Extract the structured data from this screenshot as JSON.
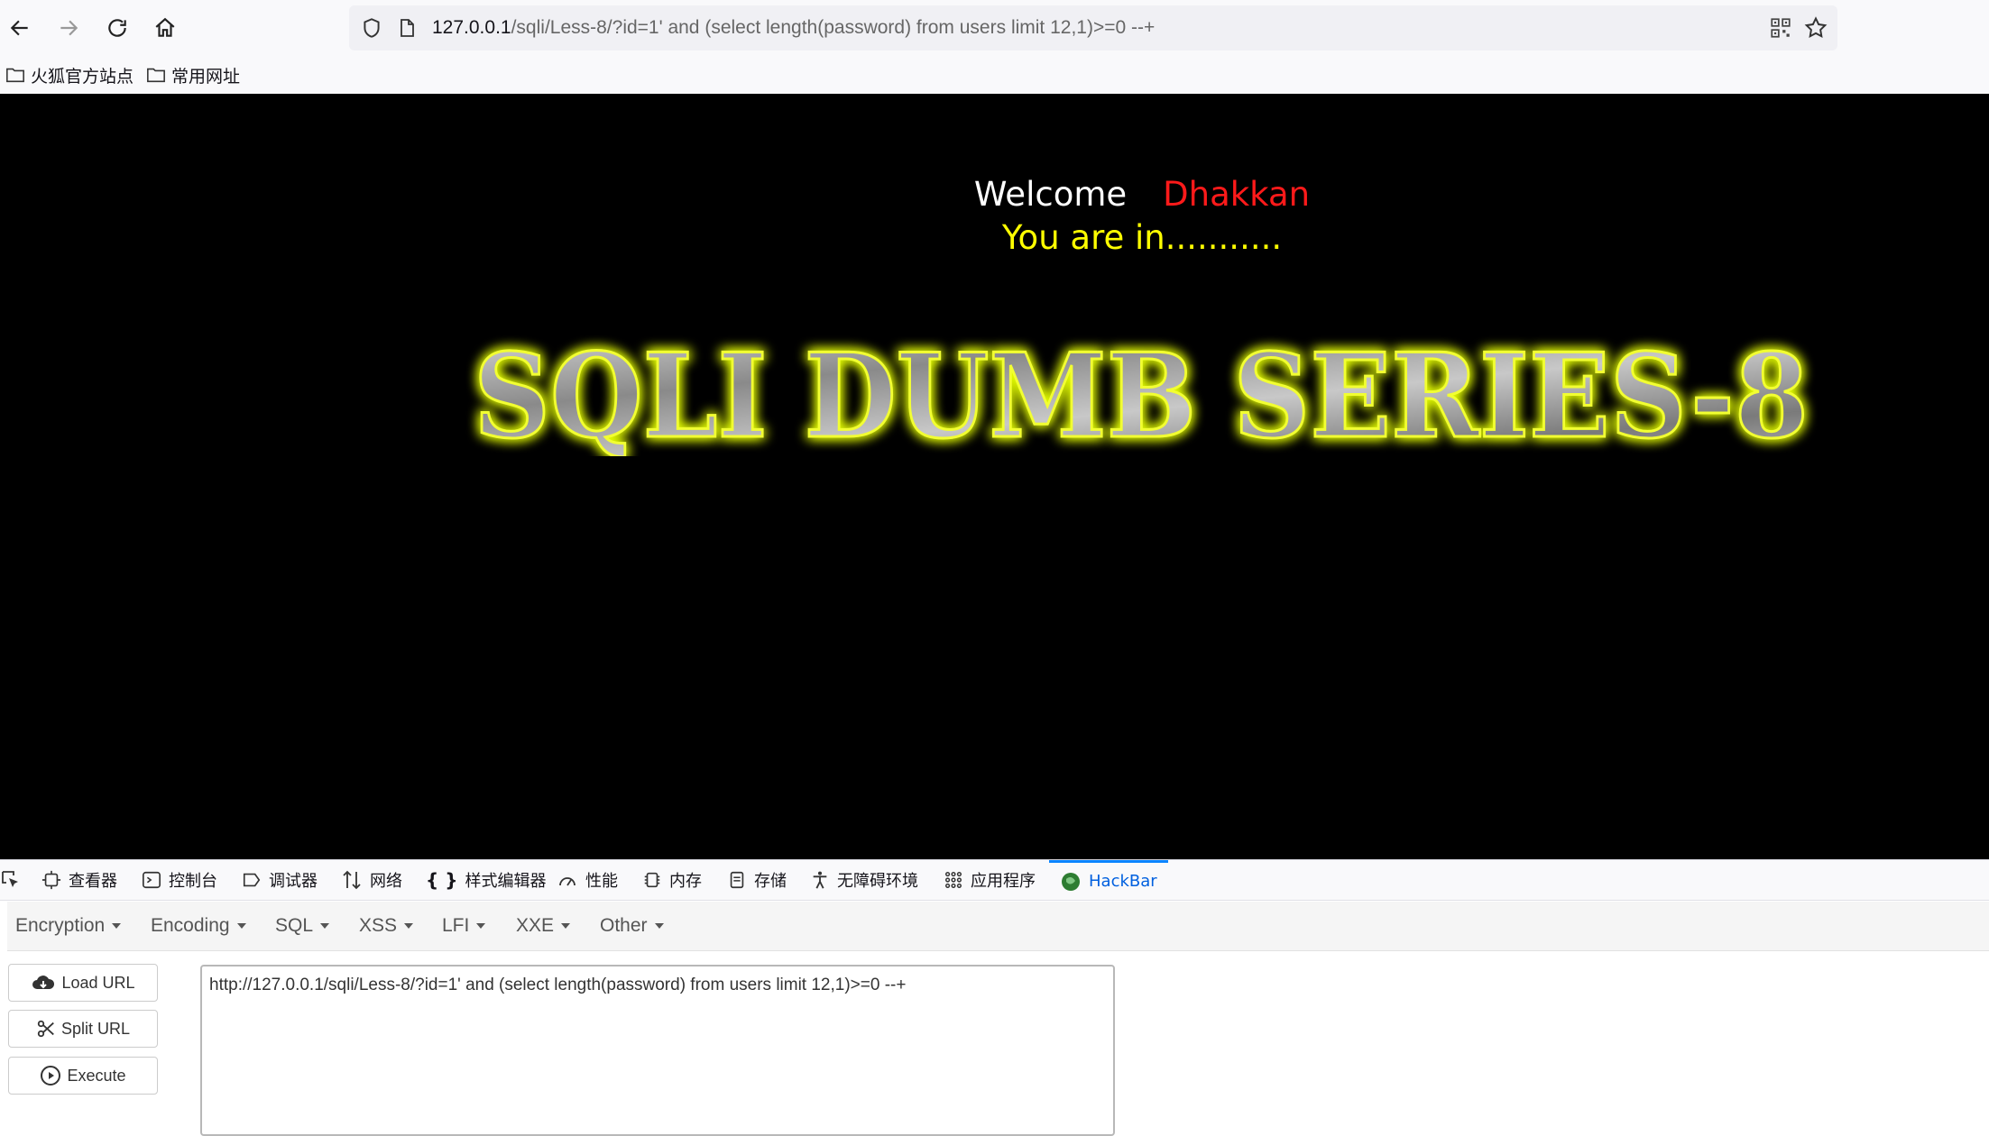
{
  "browser": {
    "url_host": "127.0.0.1",
    "url_path": "/sqli/Less-8/?id=1' and (select length(password) from users limit 12,1)>=0 --+"
  },
  "bookmarks": [
    {
      "label": "火狐官方站点"
    },
    {
      "label": "常用网址"
    }
  ],
  "page": {
    "welcome": "Welcome",
    "user": "Dhakkan",
    "status": "You are in...........",
    "banner": "SQLI DUMB SERIES-8"
  },
  "devtools": {
    "tabs": [
      {
        "label": "查看器",
        "icon": "inspector-icon"
      },
      {
        "label": "控制台",
        "icon": "console-icon"
      },
      {
        "label": "调试器",
        "icon": "debugger-icon"
      },
      {
        "label": "网络",
        "icon": "network-icon"
      },
      {
        "label": "样式编辑器",
        "icon": "style-editor-icon"
      },
      {
        "label": "性能",
        "icon": "performance-icon"
      },
      {
        "label": "内存",
        "icon": "memory-icon"
      },
      {
        "label": "存储",
        "icon": "storage-icon"
      },
      {
        "label": "无障碍环境",
        "icon": "accessibility-icon"
      },
      {
        "label": "应用程序",
        "icon": "application-icon"
      },
      {
        "label": "HackBar",
        "icon": "hackbar-icon"
      }
    ]
  },
  "hackbar": {
    "menus": [
      "Encryption",
      "Encoding",
      "SQL",
      "XSS",
      "LFI",
      "XXE",
      "Other"
    ],
    "load_url": "Load URL",
    "split_url": "Split URL",
    "execute": "Execute",
    "url_value": "http://127.0.0.1/sqli/Less-8/?id=1' and (select length(password) from users limit 12,1)>=0 --+"
  }
}
